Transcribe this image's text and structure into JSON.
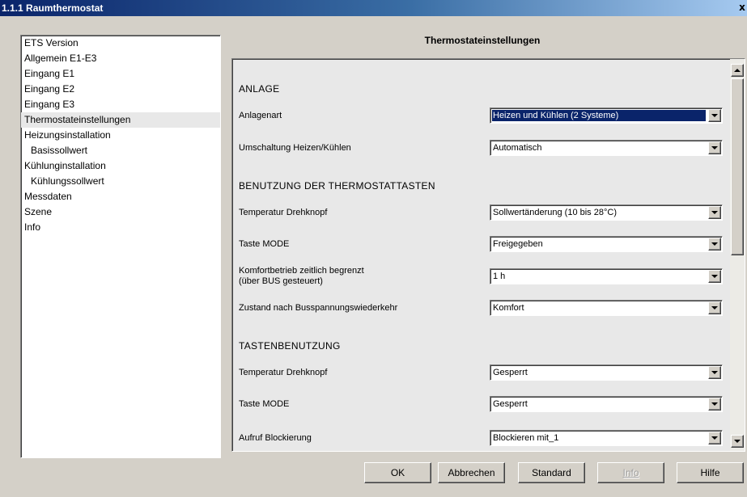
{
  "window": {
    "title": "1.1.1 Raumthermostat",
    "close_glyph": "x"
  },
  "sidebar": {
    "items": [
      {
        "label": "ETS Version",
        "indent": false,
        "selected": false
      },
      {
        "label": "Allgemein E1-E3",
        "indent": false,
        "selected": false
      },
      {
        "label": "Eingang E1",
        "indent": false,
        "selected": false
      },
      {
        "label": "Eingang E2",
        "indent": false,
        "selected": false
      },
      {
        "label": "Eingang E3",
        "indent": false,
        "selected": false
      },
      {
        "label": "Thermostateinstellungen",
        "indent": false,
        "selected": true
      },
      {
        "label": "Heizungsinstallation",
        "indent": false,
        "selected": false
      },
      {
        "label": "Basissollwert",
        "indent": true,
        "selected": false
      },
      {
        "label": "Kühlunginstallation",
        "indent": false,
        "selected": false
      },
      {
        "label": "Kühlungssollwert",
        "indent": true,
        "selected": false
      },
      {
        "label": "Messdaten",
        "indent": false,
        "selected": false
      },
      {
        "label": "Szene",
        "indent": false,
        "selected": false
      },
      {
        "label": "Info",
        "indent": false,
        "selected": false
      }
    ]
  },
  "main": {
    "title": "Thermostateinstellungen",
    "sections": {
      "anlage": "ANLAGE",
      "benutzung": "BENUTZUNG DER THERMOSTATTASTEN",
      "tasten": "TASTENBENUTZUNG"
    },
    "params": {
      "anlagenart": {
        "label": "Anlagenart",
        "value": "Heizen und Kühlen (2 Systeme)"
      },
      "umschaltung": {
        "label": "Umschaltung Heizen/Kühlen",
        "value": "Automatisch"
      },
      "drehknopf1": {
        "label": "Temperatur Drehknopf",
        "value": "Sollwertänderung (10 bis 28°C)"
      },
      "mode1": {
        "label": "Taste MODE",
        "value": "Freigegeben"
      },
      "komfort": {
        "label_line1": "Komfortbetrieb zeitlich begrenzt",
        "label_line2": "(über BUS gesteuert)",
        "value": "1 h"
      },
      "zustand": {
        "label": "Zustand nach Busspannungswiederkehr",
        "value": "Komfort"
      },
      "drehknopf2": {
        "label": "Temperatur Drehknopf",
        "value": "Gesperrt"
      },
      "mode2": {
        "label": "Taste MODE",
        "value": "Gesperrt"
      },
      "blockierung": {
        "label": "Aufruf Blockierung",
        "value": "Blockieren mit_1"
      }
    }
  },
  "buttons": {
    "ok": "OK",
    "cancel": "Abbrechen",
    "standard": "Standard",
    "info": "Info",
    "help": "Hilfe"
  },
  "colors": {
    "title_bar": "#0a246a",
    "dialog_bg": "#d4d0c8",
    "selection": "#0a246a",
    "panel_bg": "#e8e8e8"
  }
}
